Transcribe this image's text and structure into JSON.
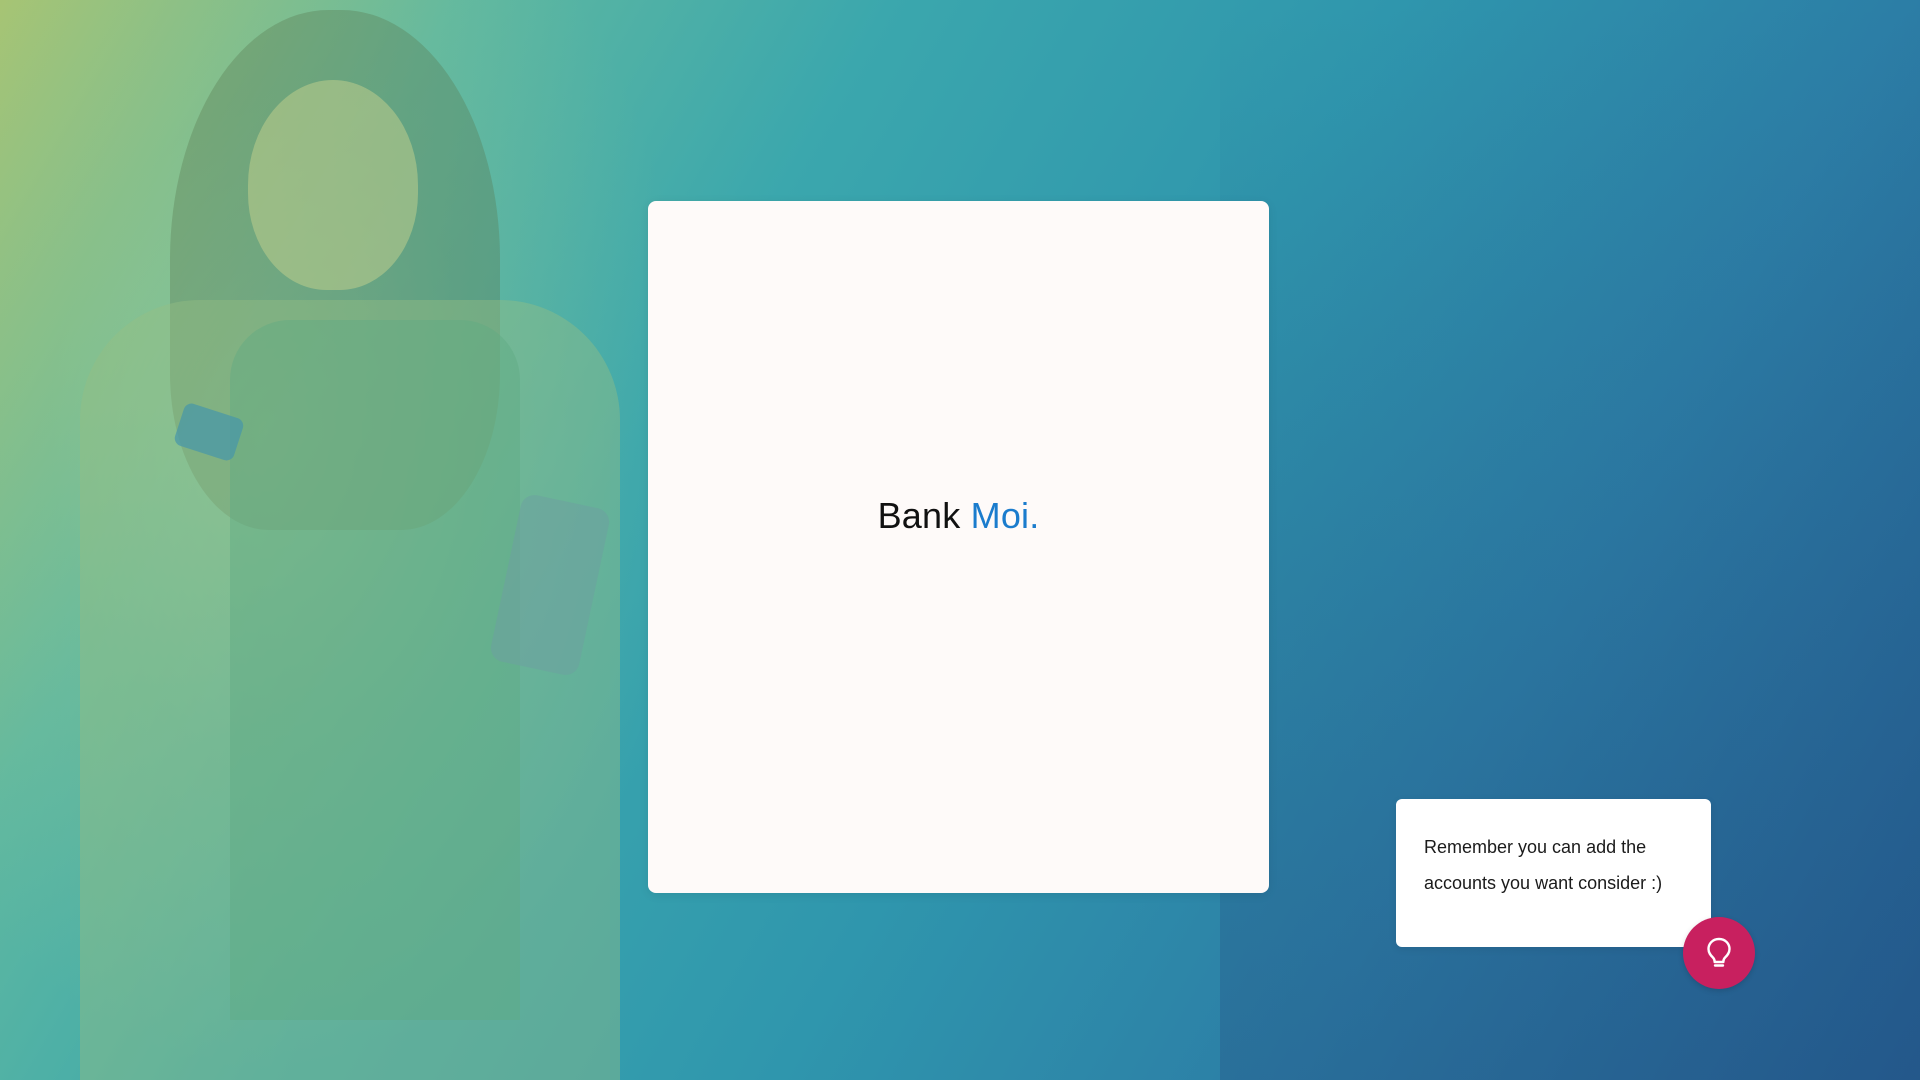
{
  "background": {
    "gradient_colors": [
      "#a7c473",
      "#3ba7ad",
      "#245c8f"
    ]
  },
  "card": {
    "logo": {
      "bank": "Bank",
      "moi": "Moi."
    },
    "logo_colors": {
      "bank": "#111111",
      "moi": "#1b7ccd"
    }
  },
  "tip": {
    "text": "Remember you can add the accounts you want consider :)",
    "button_icon": "lightbulb-icon",
    "button_color": "#c8205f"
  }
}
